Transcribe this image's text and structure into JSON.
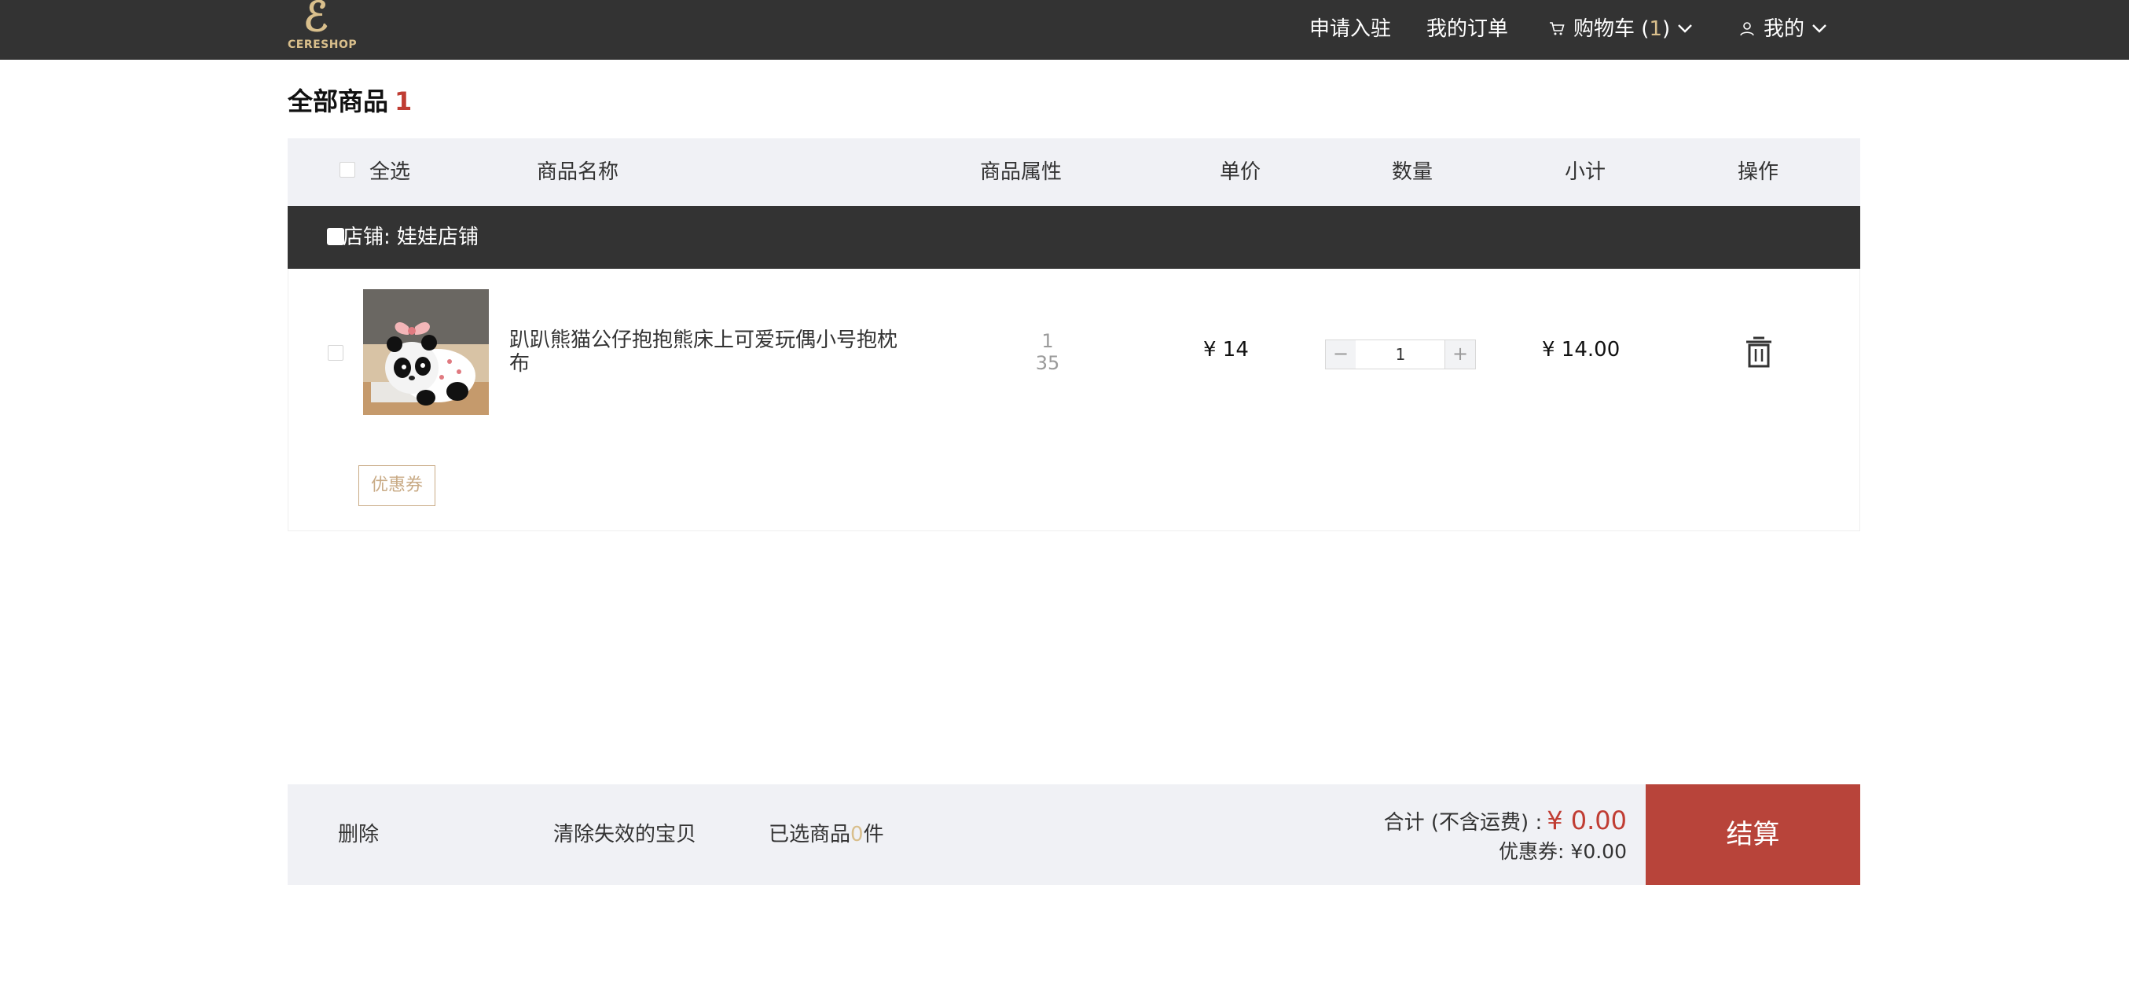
{
  "header": {
    "logo_text": "CERESHOP",
    "nav": {
      "apply": "申请入驻",
      "orders": "我的订单",
      "cart_label": "购物车",
      "cart_open": " (",
      "cart_count": "1",
      "cart_close": ")",
      "mine": "我的"
    }
  },
  "page": {
    "title": "全部商品",
    "count": "1"
  },
  "table_header": {
    "select_all": "全选",
    "name": "商品名称",
    "attributes": "商品属性",
    "unit_price": "单价",
    "quantity": "数量",
    "subtotal": "小计",
    "actions": "操作"
  },
  "shop": {
    "label": "店铺: 娃娃店铺"
  },
  "items": [
    {
      "name": "趴趴熊猫公仔抱抱熊床上可爱玩偶小号抱枕布",
      "attr_line1": "1",
      "attr_line2": "35",
      "price": "¥ 14",
      "quantity": "1",
      "subtotal": "¥ 14.00",
      "image_icon": "panda-plush-image"
    }
  ],
  "coupon_button": "优惠券",
  "footer": {
    "delete": "删除",
    "clear_invalid": "清除失效的宝贝",
    "selected_prefix": "已选商品",
    "selected_count": "0",
    "selected_suffix": "件",
    "total_label": "合计 (不含运费) :",
    "total_amount": "¥ 0.00",
    "coupon_line": "优惠券: ¥0.00",
    "checkout": "结算"
  },
  "colors": {
    "header_bg": "#333333",
    "accent_gold": "#d9bf8c",
    "price_red": "#c03d33",
    "checkout_bg": "#b8443a",
    "panel_bg": "#f0f1f5"
  }
}
